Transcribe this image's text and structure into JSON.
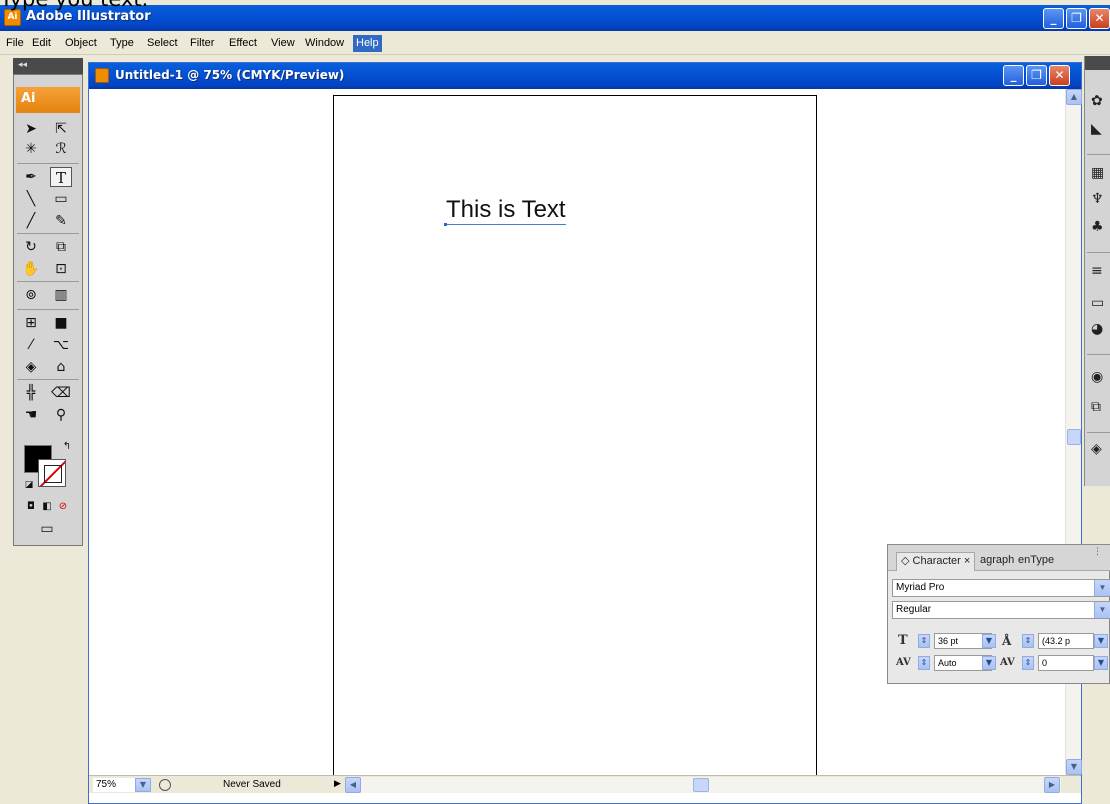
{
  "caption": "Type you text.",
  "app": {
    "title": "Adobe Illustrator",
    "icon": "Ai"
  },
  "window_controls": {
    "minimize": "_",
    "restore": "❐",
    "close": "✕"
  },
  "menu": [
    {
      "label": "File",
      "active": false
    },
    {
      "label": "Edit",
      "active": false
    },
    {
      "label": "Object",
      "active": false
    },
    {
      "label": "Type",
      "active": false
    },
    {
      "label": "Select",
      "active": false
    },
    {
      "label": "Filter",
      "active": false
    },
    {
      "label": "Effect",
      "active": false
    },
    {
      "label": "View",
      "active": false
    },
    {
      "label": "Window",
      "active": false
    },
    {
      "label": "Help",
      "active": true
    }
  ],
  "toolbox": {
    "collapse_label": "◂◂",
    "badge": "Ai",
    "tools": [
      "selection-tool",
      "direct-selection-tool",
      "magic-wand-tool",
      "lasso-tool",
      "pen-tool",
      "type-tool",
      "line-segment-tool",
      "rectangle-tool",
      "paintbrush-tool",
      "pencil-tool",
      "rotate-tool",
      "scale-tool",
      "warp-tool",
      "free-transform-tool",
      "symbol-sprayer-tool",
      "graph-tool",
      "mesh-tool",
      "gradient-tool",
      "eyedropper-tool",
      "blend-tool",
      "live-paint-bucket-tool",
      "live-paint-selection-tool",
      "slice-tool",
      "eraser-tool",
      "hand-tool",
      "zoom-tool"
    ],
    "selected_tool": "type-tool",
    "fill_color": "#000000",
    "stroke": "none"
  },
  "document": {
    "title": "Untitled-1 @ 75% (CMYK/Preview)",
    "artboard_text": "This is Text",
    "zoom": "75%",
    "status": "Never Saved"
  },
  "character_panel": {
    "tabs": [
      "◇ Character ×",
      "agraph",
      "enType"
    ],
    "font_family": "Myriad Pro",
    "font_style": "Regular",
    "font_size": "36 pt",
    "leading": "(43.2 p",
    "kerning": "Auto",
    "tracking": "0"
  },
  "colors": {
    "xp_blue": "#0453d6",
    "ai_orange": "#e5830e",
    "menu_highlight": "#316ac5"
  }
}
